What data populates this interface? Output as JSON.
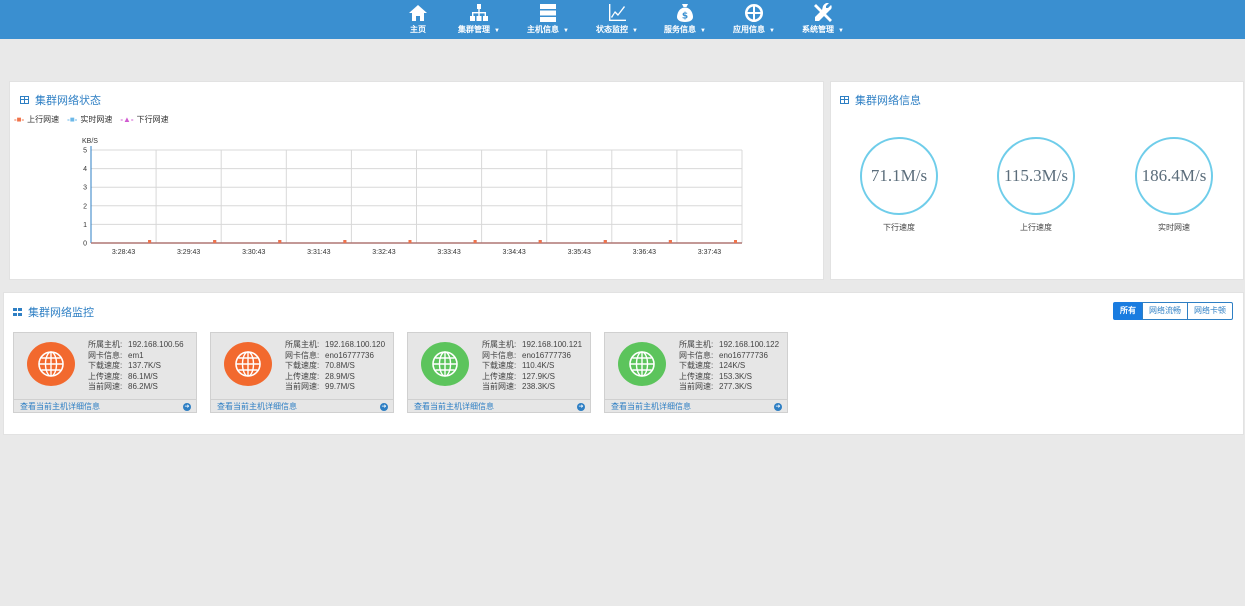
{
  "nav": [
    {
      "label": "主页",
      "icon": "home-icon",
      "caret": false
    },
    {
      "label": "集群管理",
      "icon": "sitemap-icon",
      "caret": true
    },
    {
      "label": "主机信息",
      "icon": "server-icon",
      "caret": true
    },
    {
      "label": "状态监控",
      "icon": "line-chart-icon",
      "caret": true
    },
    {
      "label": "服务信息",
      "icon": "money-bag-icon",
      "caret": true
    },
    {
      "label": "应用信息",
      "icon": "grid-app-icon",
      "caret": true
    },
    {
      "label": "系统管理",
      "icon": "wrench-icon",
      "caret": true
    }
  ],
  "status_panel": {
    "title": "集群网络状态",
    "legend": [
      {
        "label": "上行网速",
        "color": "#f0734a",
        "marker": "-■-"
      },
      {
        "label": "实时网速",
        "color": "#6cb8e8",
        "marker": "-■-"
      },
      {
        "label": "下行网速",
        "color": "#d05bd0",
        "marker": "-▲-"
      }
    ]
  },
  "chart_data": {
    "type": "line",
    "title": "",
    "ylabel": "KB/S",
    "xlabel": "",
    "ylim": [
      0,
      5
    ],
    "yticks": [
      0,
      1,
      2,
      3,
      4,
      5
    ],
    "categories": [
      "3:28:43",
      "3:29:43",
      "3:30:43",
      "3:31:43",
      "3:32:43",
      "3:33:43",
      "3:34:43",
      "3:35:43",
      "3:36:43",
      "3:37:43"
    ],
    "series": [
      {
        "name": "上行网速",
        "color": "#f0734a",
        "values": [
          0,
          0,
          0,
          0,
          0,
          0,
          0,
          0,
          0,
          0
        ]
      },
      {
        "name": "实时网速",
        "color": "#6cb8e8",
        "values": [
          0,
          0,
          0,
          0,
          0,
          0,
          0,
          0,
          0,
          0
        ]
      },
      {
        "name": "下行网速",
        "color": "#d05bd0",
        "values": [
          0,
          0,
          0,
          0,
          0,
          0,
          0,
          0,
          0,
          0
        ]
      }
    ],
    "grid": true,
    "legend_position": "top-left"
  },
  "info_panel": {
    "title": "集群网络信息",
    "gauges": [
      {
        "value": "71.1M/s",
        "label": "下行速度"
      },
      {
        "value": "115.3M/s",
        "label": "上行速度"
      },
      {
        "value": "186.4M/s",
        "label": "实时网速"
      }
    ]
  },
  "monitor_panel": {
    "title": "集群网络监控",
    "filters": [
      {
        "label": "所有",
        "active": true
      },
      {
        "label": "网络流畅",
        "active": false
      },
      {
        "label": "网络卡顿",
        "active": false
      }
    ],
    "keys": {
      "host": "所属主机:",
      "nic": "网卡信息:",
      "down": "下载速度:",
      "up": "上传速度:",
      "current": "当前网速:"
    },
    "link_label": "查看当前主机详细信息",
    "hosts": [
      {
        "host": "192.168.100.56",
        "nic": "em1",
        "down": "137.7K/S",
        "up": "86.1M/S",
        "current": "86.2M/S",
        "status_color": "#f2692e"
      },
      {
        "host": "192.168.100.120",
        "nic": "eno16777736",
        "down": "70.8M/S",
        "up": "28.9M/S",
        "current": "99.7M/S",
        "status_color": "#f2692e"
      },
      {
        "host": "192.168.100.121",
        "nic": "eno16777736",
        "down": "110.4K/S",
        "up": "127.9K/S",
        "current": "238.3K/S",
        "status_color": "#5cc45c"
      },
      {
        "host": "192.168.100.122",
        "nic": "eno16777736",
        "down": "124K/S",
        "up": "153.3K/S",
        "current": "277.3K/S",
        "status_color": "#5cc45c"
      }
    ]
  }
}
